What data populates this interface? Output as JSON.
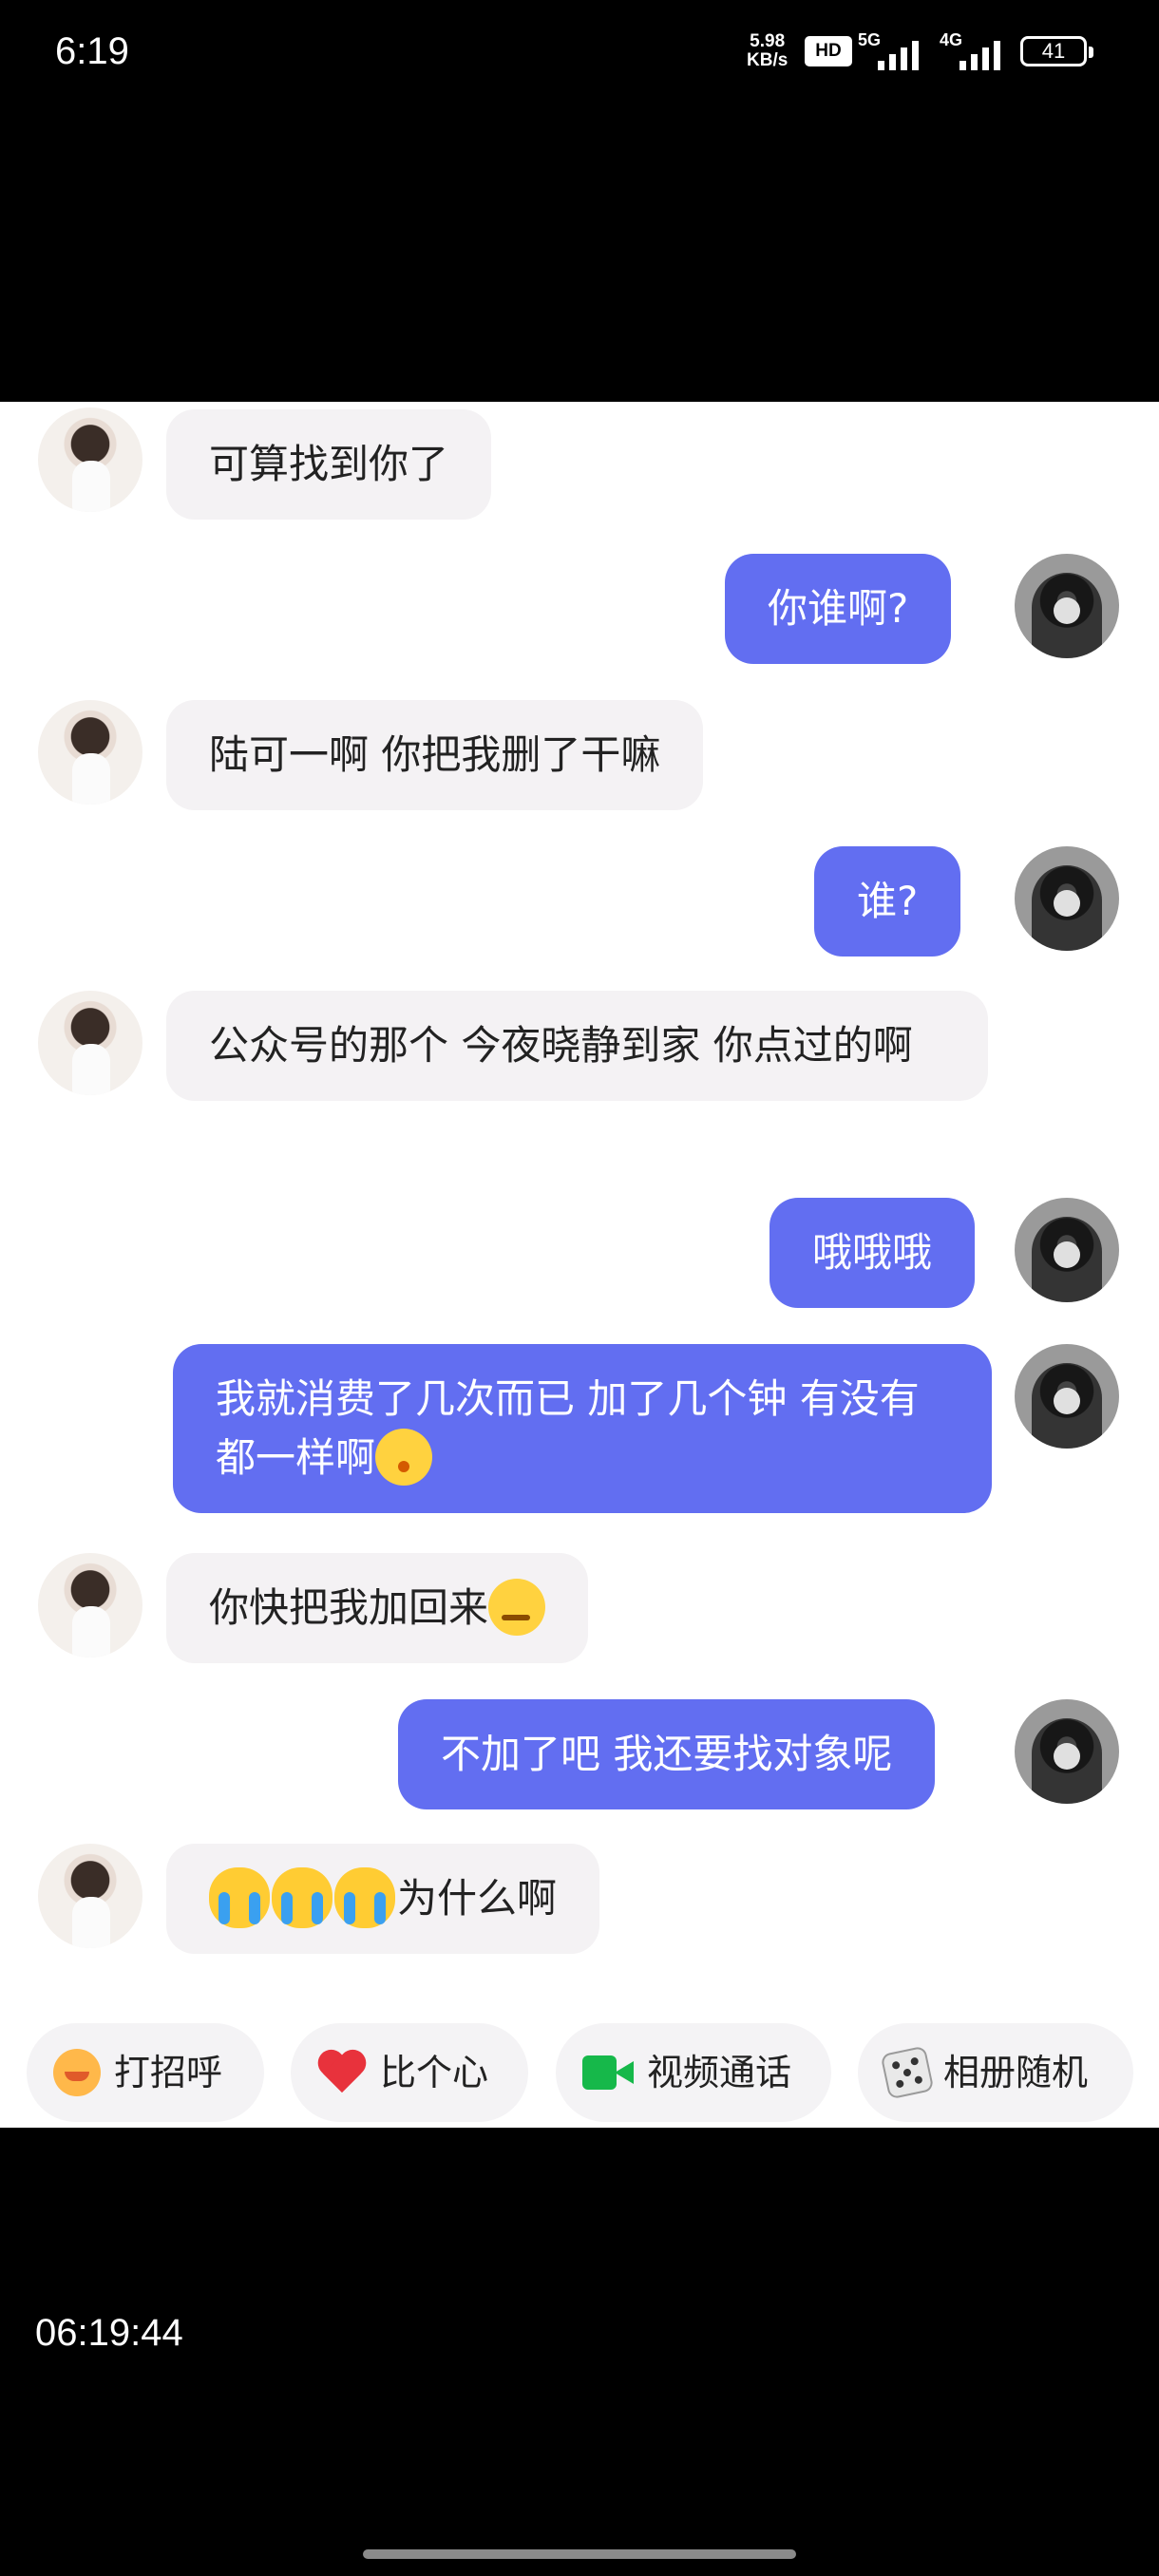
{
  "status_bar": {
    "time": "6:19",
    "net_speed_value": "5.98",
    "net_speed_unit": "KB/s",
    "hd_badge": "HD",
    "signal1_label": "5G",
    "signal2_label": "4G",
    "battery": "41",
    "icons": [
      "hd-icon",
      "signal-5g-icon",
      "signal-4g-icon",
      "battery-icon"
    ]
  },
  "messages": [
    {
      "side": "left",
      "text": "可算找到你了"
    },
    {
      "side": "right",
      "text": "你谁啊?"
    },
    {
      "side": "left",
      "text": "陆可一啊 你把我删了干嘛"
    },
    {
      "side": "right",
      "text": "谁?"
    },
    {
      "side": "left",
      "text": "公众号的那个 今夜晓静到家 你点过的啊"
    },
    {
      "side": "right",
      "text": "哦哦哦"
    },
    {
      "side": "right",
      "text": "我就消费了几次而已 加了几个钟 有没有都一样啊",
      "emoji": "kissing-face-emoji"
    },
    {
      "side": "left",
      "text": "你快把我加回来",
      "emoji": "smug-face-emoji"
    },
    {
      "side": "right",
      "text": "不加了吧 我还要找对象呢"
    },
    {
      "side": "left",
      "emojis_before": [
        "crying-face-emoji",
        "crying-face-emoji",
        "crying-face-emoji"
      ],
      "text": "为什么啊"
    }
  ],
  "quick_actions": [
    {
      "label": "打招呼",
      "icon": "wave-icon"
    },
    {
      "label": "比个心",
      "icon": "heart-icon"
    },
    {
      "label": "视频通话",
      "icon": "video-call-icon"
    },
    {
      "label": "相册随机",
      "icon": "dice-icon"
    }
  ],
  "overlay_time": "06:19:44",
  "colors": {
    "outgoing_bubble": "#626ef1",
    "incoming_bubble": "#f4f2f4",
    "background": "#000000"
  }
}
